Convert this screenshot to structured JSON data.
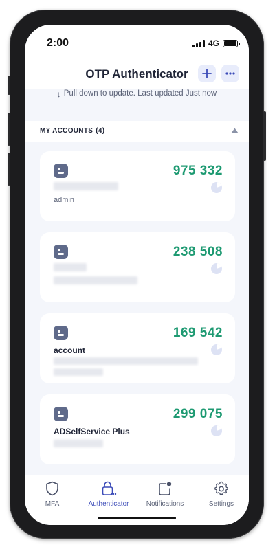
{
  "status_bar": {
    "time": "2:00",
    "network": "4G"
  },
  "header": {
    "title": "OTP Authenticator"
  },
  "pull_hint": {
    "text": "Pull down to update. Last updated Just now"
  },
  "section": {
    "title": "MY ACCOUNTS",
    "count": "(4)"
  },
  "accounts": [
    {
      "otp": "975 332",
      "name": "",
      "sub": "admin"
    },
    {
      "otp": "238 508",
      "name": "",
      "sub": ""
    },
    {
      "otp": "169 542",
      "name": "account",
      "sub": ""
    },
    {
      "otp": "299 075",
      "name": "ADSelfService Plus",
      "sub": ""
    }
  ],
  "tabs": [
    {
      "label": "MFA"
    },
    {
      "label": "Authenticator"
    },
    {
      "label": "Notifications"
    },
    {
      "label": "Settings"
    }
  ],
  "colors": {
    "otp_green": "#1e9a72",
    "accent": "#3b4bb8",
    "icon_slate": "#5f6a8a"
  }
}
